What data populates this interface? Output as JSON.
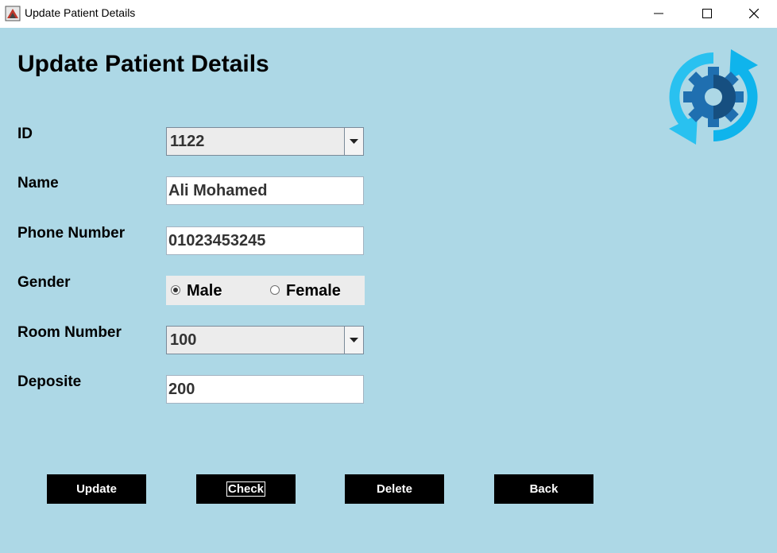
{
  "window": {
    "title": "Update Patient Details",
    "controls": [
      "minimize-icon",
      "maximize-icon",
      "close-icon"
    ]
  },
  "form": {
    "heading": "Update Patient Details",
    "id": {
      "label": "ID",
      "value": "1122"
    },
    "name": {
      "label": "Name",
      "value": "Ali Mohamed"
    },
    "phone": {
      "label": "Phone Number",
      "value": "01023453245"
    },
    "gender": {
      "label": "Gender",
      "options": [
        "Male",
        "Female"
      ],
      "selected": "Male"
    },
    "room": {
      "label": "Room Number",
      "value": "100"
    },
    "deposit": {
      "label": "Deposite",
      "value": "200"
    }
  },
  "buttons": {
    "update": "Update",
    "check": "Check",
    "delete": "Delete",
    "back": "Back"
  },
  "colors": {
    "background": "#add8e6",
    "button_bg": "#000000",
    "button_text": "#ffffff",
    "logo_light": "#29c1f0",
    "logo_dark": "#1f6fb0"
  },
  "icons": {
    "logo": "update-gear-icon"
  }
}
